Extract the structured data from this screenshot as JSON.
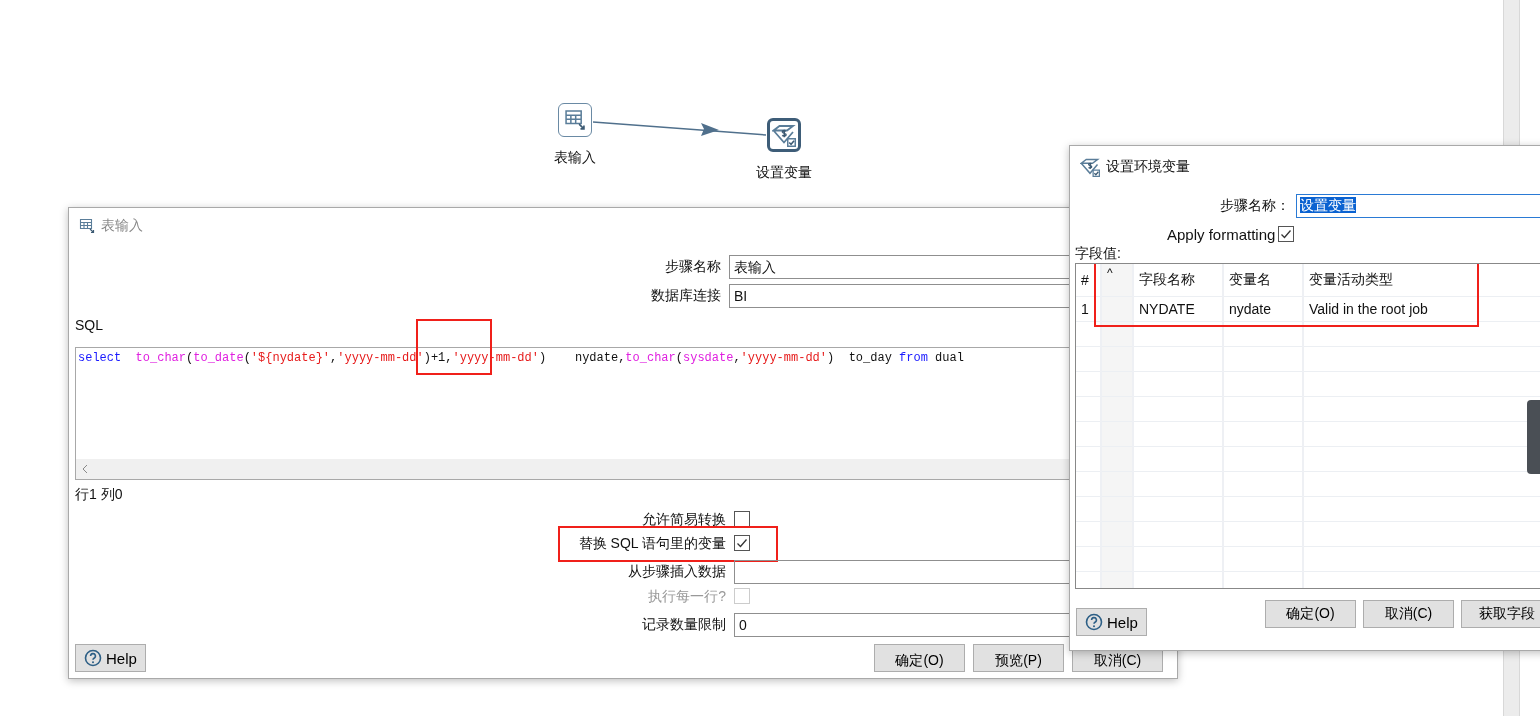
{
  "canvas": {
    "nodes": [
      {
        "label": "表输入",
        "kind": "table-input",
        "selected": false
      },
      {
        "label": "设置变量",
        "kind": "set-variable",
        "selected": true
      }
    ]
  },
  "table_input_dialog": {
    "title": "表输入",
    "fields": [
      {
        "label": "步骤名称",
        "value": "表输入"
      },
      {
        "label": "数据库连接",
        "value": "BI"
      }
    ],
    "sql_label": "SQL",
    "sql_editor": {
      "highlighted": true,
      "tokens": [
        {
          "text": "select  ",
          "kind": "keyword"
        },
        {
          "text": "to_char",
          "kind": "function"
        },
        {
          "text": "(",
          "kind": "plain"
        },
        {
          "text": "to_date",
          "kind": "function"
        },
        {
          "text": "(",
          "kind": "plain"
        },
        {
          "text": "'${nydate}'",
          "kind": "string"
        },
        {
          "text": ",",
          "kind": "plain"
        },
        {
          "text": "'yyyy-mm-dd'",
          "kind": "string"
        },
        {
          "text": ")+1,",
          "kind": "plain"
        },
        {
          "text": "'yyyy-mm-dd'",
          "kind": "string"
        },
        {
          "text": ")    nydate,",
          "kind": "plain"
        },
        {
          "text": "to_char",
          "kind": "function"
        },
        {
          "text": "(",
          "kind": "plain"
        },
        {
          "text": "sysdate",
          "kind": "function"
        },
        {
          "text": ",",
          "kind": "plain"
        },
        {
          "text": "'yyyy-mm-dd'",
          "kind": "string"
        },
        {
          "text": ")  to_day ",
          "kind": "plain"
        },
        {
          "text": "from",
          "kind": "keyword"
        },
        {
          "text": " dual",
          "kind": "plain"
        }
      ]
    },
    "cursor_position": "行1 列0",
    "options": [
      {
        "label": "允许简易转换",
        "kind": "checkbox",
        "checked": false,
        "disabled": false,
        "highlighted": false
      },
      {
        "label": "替换 SQL 语句里的变量",
        "kind": "checkbox",
        "checked": true,
        "disabled": false,
        "highlighted": true
      },
      {
        "label": "从步骤插入数据",
        "kind": "field"
      },
      {
        "label": "执行每一行?",
        "kind": "checkbox",
        "checked": false,
        "disabled": true,
        "highlighted": false
      },
      {
        "label": "记录数量限制",
        "kind": "field",
        "value": "0"
      }
    ],
    "help_button": "Help",
    "buttons": [
      "确定(O)",
      "预览(P)",
      "取消(C)"
    ]
  },
  "set_variable_dialog": {
    "title": "设置环境变量",
    "step_name": {
      "label": "步骤名称：",
      "value": "设置变量",
      "value_selected": true
    },
    "apply_formatting": {
      "label": "Apply formatting",
      "checked": true
    },
    "table_label": "字段值:",
    "table": {
      "highlighted": true,
      "columns": [
        "#",
        "^",
        "字段名称",
        "变量名",
        "变量活动类型"
      ],
      "rows": [
        [
          "1",
          "",
          "NYDATE",
          "nydate",
          "Valid in the root job"
        ]
      ]
    },
    "help_button": "Help",
    "buttons": [
      "确定(O)",
      "取消(C)",
      "获取字段"
    ]
  }
}
